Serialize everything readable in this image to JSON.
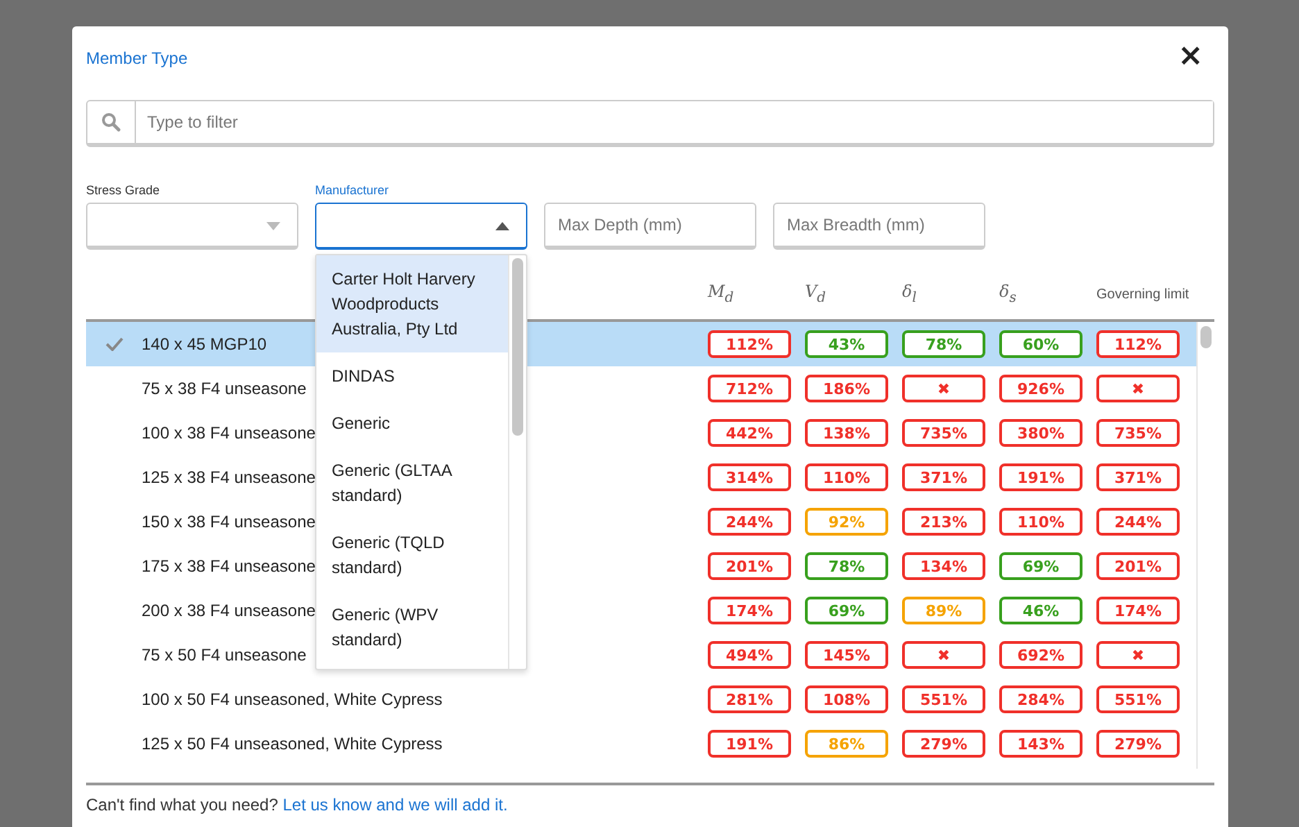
{
  "dialog": {
    "title": "Member Type",
    "close": "×"
  },
  "filter": {
    "placeholder": "Type to filter"
  },
  "filters": [
    {
      "kind": "select",
      "label": "Stress Grade",
      "focused": false,
      "expanded": false
    },
    {
      "kind": "select",
      "label": "Manufacturer",
      "focused": true,
      "expanded": true,
      "options": [
        {
          "label": "Carter Holt Harvery Woodproducts Australia, Pty Ltd",
          "selected": true
        },
        {
          "label": "DINDAS",
          "selected": false
        },
        {
          "label": "Generic",
          "selected": false
        },
        {
          "label": "Generic (GLTAA standard)",
          "selected": false
        },
        {
          "label": "Generic (TQLD standard)",
          "selected": false
        },
        {
          "label": "Generic (WPV standard)",
          "selected": false
        }
      ]
    },
    {
      "kind": "input",
      "placeholder": "Max Depth (mm)"
    },
    {
      "kind": "input",
      "placeholder": "Max Breadth (mm)"
    }
  ],
  "table": {
    "columns": [
      "M$_{d}$",
      "V$_{d}$",
      "δ$_{l}$",
      "δ$_{s}$",
      "Governing limit"
    ],
    "rows": [
      {
        "name": "140 x 45 MGP10",
        "selected": true,
        "cells": [
          {
            "text": "112%",
            "color": "#f0302a"
          },
          {
            "text": "43%",
            "color": "#38a01e"
          },
          {
            "text": "78%",
            "color": "#38a01e"
          },
          {
            "text": "60%",
            "color": "#38a01e"
          },
          {
            "text": "112%",
            "color": "#f0302a"
          }
        ]
      },
      {
        "name": "75 x 38 F4 unseasone",
        "selected": false,
        "cells": [
          {
            "text": "712%",
            "color": "#f0302a"
          },
          {
            "text": "186%",
            "color": "#f0302a"
          },
          {
            "text": "✖",
            "color": "#f0302a"
          },
          {
            "text": "926%",
            "color": "#f0302a"
          },
          {
            "text": "✖",
            "color": "#f0302a"
          }
        ]
      },
      {
        "name": "100 x 38 F4 unseasone",
        "selected": false,
        "cells": [
          {
            "text": "442%",
            "color": "#f0302a"
          },
          {
            "text": "138%",
            "color": "#f0302a"
          },
          {
            "text": "735%",
            "color": "#f0302a"
          },
          {
            "text": "380%",
            "color": "#f0302a"
          },
          {
            "text": "735%",
            "color": "#f0302a"
          }
        ]
      },
      {
        "name": "125 x 38 F4 unseasone",
        "selected": false,
        "cells": [
          {
            "text": "314%",
            "color": "#f0302a"
          },
          {
            "text": "110%",
            "color": "#f0302a"
          },
          {
            "text": "371%",
            "color": "#f0302a"
          },
          {
            "text": "191%",
            "color": "#f0302a"
          },
          {
            "text": "371%",
            "color": "#f0302a"
          }
        ]
      },
      {
        "name": "150 x 38 F4 unseasone",
        "selected": false,
        "cells": [
          {
            "text": "244%",
            "color": "#f0302a"
          },
          {
            "text": "92%",
            "color": "#f5a300"
          },
          {
            "text": "213%",
            "color": "#f0302a"
          },
          {
            "text": "110%",
            "color": "#f0302a"
          },
          {
            "text": "244%",
            "color": "#f0302a"
          }
        ]
      },
      {
        "name": "175 x 38 F4 unseasone",
        "selected": false,
        "cells": [
          {
            "text": "201%",
            "color": "#f0302a"
          },
          {
            "text": "78%",
            "color": "#38a01e"
          },
          {
            "text": "134%",
            "color": "#f0302a"
          },
          {
            "text": "69%",
            "color": "#38a01e"
          },
          {
            "text": "201%",
            "color": "#f0302a"
          }
        ]
      },
      {
        "name": "200 x 38 F4 unseasone",
        "selected": false,
        "cells": [
          {
            "text": "174%",
            "color": "#f0302a"
          },
          {
            "text": "69%",
            "color": "#38a01e"
          },
          {
            "text": "89%",
            "color": "#f5a300"
          },
          {
            "text": "46%",
            "color": "#38a01e"
          },
          {
            "text": "174%",
            "color": "#f0302a"
          }
        ]
      },
      {
        "name": "75 x 50 F4 unseasone",
        "selected": false,
        "cells": [
          {
            "text": "494%",
            "color": "#f0302a"
          },
          {
            "text": "145%",
            "color": "#f0302a"
          },
          {
            "text": "✖",
            "color": "#f0302a"
          },
          {
            "text": "692%",
            "color": "#f0302a"
          },
          {
            "text": "✖",
            "color": "#f0302a"
          }
        ]
      },
      {
        "name": "100 x 50 F4 unseasoned, White Cypress",
        "selected": false,
        "cells": [
          {
            "text": "281%",
            "color": "#f0302a"
          },
          {
            "text": "108%",
            "color": "#f0302a"
          },
          {
            "text": "551%",
            "color": "#f0302a"
          },
          {
            "text": "284%",
            "color": "#f0302a"
          },
          {
            "text": "551%",
            "color": "#f0302a"
          }
        ]
      },
      {
        "name": "125 x 50 F4 unseasoned, White Cypress",
        "selected": false,
        "cells": [
          {
            "text": "191%",
            "color": "#f0302a"
          },
          {
            "text": "86%",
            "color": "#f5a300"
          },
          {
            "text": "279%",
            "color": "#f0302a"
          },
          {
            "text": "143%",
            "color": "#f0302a"
          },
          {
            "text": "279%",
            "color": "#f0302a"
          }
        ]
      }
    ]
  },
  "footer": {
    "text": "Can't find what you need?",
    "link": "Let us know and we will add it."
  }
}
